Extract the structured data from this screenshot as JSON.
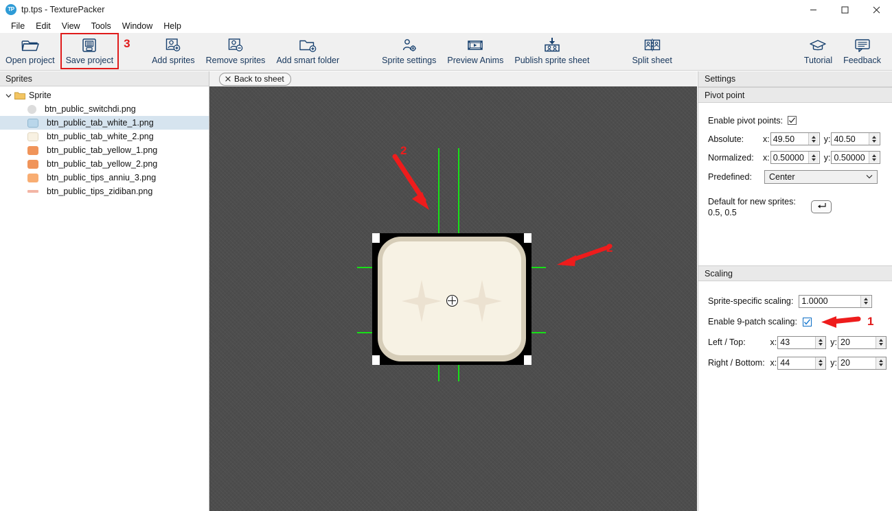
{
  "window": {
    "app_icon": "tp-logo-icon",
    "title": "tp.tps - TexturePacker",
    "minimize": "—",
    "maximize": "□",
    "close": "✕"
  },
  "menubar": {
    "items": [
      {
        "label": "File"
      },
      {
        "label": "Edit"
      },
      {
        "label": "View"
      },
      {
        "label": "Tools"
      },
      {
        "label": "Window"
      },
      {
        "label": "Help"
      }
    ]
  },
  "toolbar": {
    "items": [
      {
        "label": "Open project",
        "icon": "open-folder-icon"
      },
      {
        "label": "Save project",
        "icon": "floppy-disk-icon"
      },
      {
        "label": "Add sprites",
        "icon": "person-plus-icon"
      },
      {
        "label": "Remove sprites",
        "icon": "person-minus-icon"
      },
      {
        "label": "Add smart folder",
        "icon": "folder-plus-icon"
      },
      {
        "label": "Sprite settings",
        "icon": "person-gear-icon"
      },
      {
        "label": "Preview Anims",
        "icon": "film-play-icon"
      },
      {
        "label": "Publish sprite sheet",
        "icon": "download-sheet-icon"
      },
      {
        "label": "Split sheet",
        "icon": "split-sheet-icon"
      },
      {
        "label": "Tutorial",
        "icon": "graduation-cap-icon"
      },
      {
        "label": "Feedback",
        "icon": "speech-bubble-icon"
      }
    ],
    "annotation_save": "3"
  },
  "sprites_panel": {
    "header": "Sprites",
    "root": {
      "label": "Sprite",
      "expanded": true,
      "icon": "folder-icon"
    },
    "items": [
      {
        "label": "btn_public_switchdi.png",
        "swatch": "#dcdcdc",
        "shape": "circle"
      },
      {
        "label": "btn_public_tab_white_1.png",
        "swatch": "#b9d6ea",
        "shape": "rounded",
        "selected": true
      },
      {
        "label": "btn_public_tab_white_2.png",
        "swatch": "#f6eedf",
        "shape": "rounded"
      },
      {
        "label": "btn_public_tab_yellow_1.png",
        "swatch": "#f0945a",
        "shape": "rounded"
      },
      {
        "label": "btn_public_tab_yellow_2.png",
        "swatch": "#f0945a",
        "shape": "rounded"
      },
      {
        "label": "btn_public_tips_anniu_3.png",
        "swatch": "#f8ad72",
        "shape": "rounded"
      },
      {
        "label": "btn_public_tips_zidiban.png",
        "swatch": "#f3b5a5",
        "shape": "bar"
      }
    ]
  },
  "canvas": {
    "back_button": "Back to sheet",
    "back_icon": "close-x-icon",
    "background_color": "#4d4d4d",
    "guide_color": "#17e017",
    "annotations": [
      {
        "label": "2",
        "kind": "arrow-down-right"
      },
      {
        "label": "2",
        "kind": "arrow-left"
      }
    ]
  },
  "settings": {
    "header": "Settings",
    "pivot_point": {
      "header": "Pivot point",
      "enable_label": "Enable pivot points:",
      "enable_checked": true,
      "absolute_label": "Absolute:",
      "absolute_x_label": "x:",
      "absolute_x": "49.50",
      "absolute_y_label": "y:",
      "absolute_y": "40.50",
      "normalized_label": "Normalized:",
      "normalized_x_label": "x:",
      "normalized_x": "0.50000",
      "normalized_y_label": "y:",
      "normalized_y": "0.50000",
      "predefined_label": "Predefined:",
      "predefined_value": "Center",
      "default_label": "Default for new sprites:",
      "default_value": "0.5, 0.5",
      "reset_icon": "enter-arrow-icon"
    },
    "scaling": {
      "header": "Scaling",
      "sprite_specific_label": "Sprite-specific scaling:",
      "sprite_specific_value": "1.0000",
      "enable9_label": "Enable 9-patch scaling:",
      "enable9_checked": true,
      "annotation_9patch": "1",
      "left_top_label": "Left / Top:",
      "left_top_x_label": "x:",
      "left_top_x": "43",
      "left_top_y_label": "y:",
      "left_top_y": "20",
      "right_bottom_label": "Right / Bottom:",
      "right_bottom_x_label": "x:",
      "right_bottom_x": "44",
      "right_bottom_y_label": "y:",
      "right_bottom_y": "20"
    }
  },
  "colors": {
    "annotation_red": "#e01b1b",
    "toolbar_text": "#16365c",
    "selection": "#d6e4ef"
  }
}
